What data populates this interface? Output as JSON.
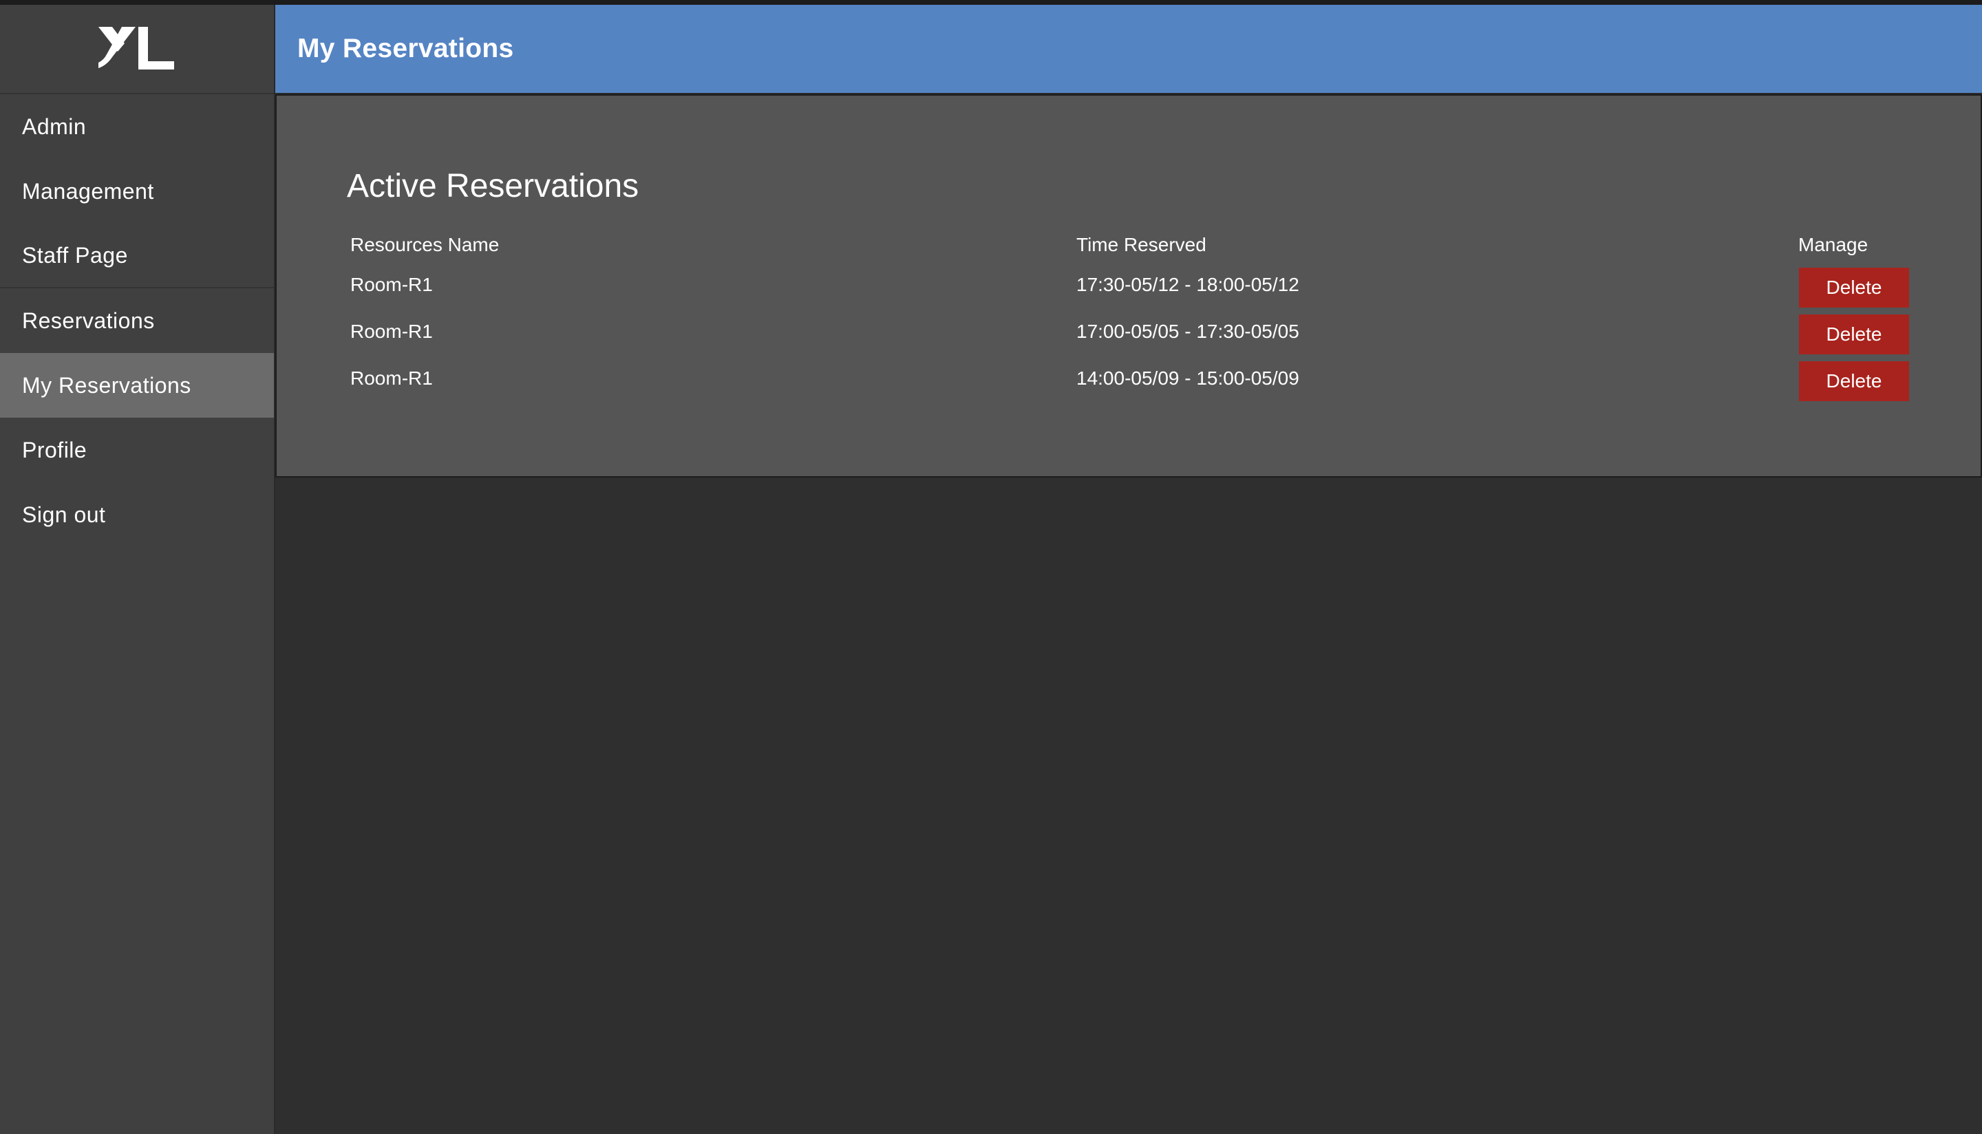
{
  "app": {
    "logo_icon": "xl-logo-icon",
    "colors": {
      "header_bg": "#5584c3",
      "sidebar_bg": "#404040",
      "active_nav_bg": "#6b6b6b",
      "panel_bg": "#555555",
      "page_bg": "#2f2f2f",
      "delete_button_bg": "#a8231d"
    }
  },
  "sidebar": {
    "items": [
      {
        "label": "Admin"
      },
      {
        "label": "Management"
      },
      {
        "label": "Staff Page"
      },
      {
        "label": "Reservations"
      },
      {
        "label": "My Reservations",
        "active": true
      },
      {
        "label": "Profile"
      },
      {
        "label": "Sign out"
      }
    ]
  },
  "header": {
    "title": "My Reservations"
  },
  "main": {
    "section_title": "Active Reservations",
    "table": {
      "columns": [
        "Resources Name",
        "Time Reserved",
        "Manage"
      ],
      "rows": [
        {
          "resource": "Room-R1",
          "time": "17:30-05/12 - 18:00-05/12",
          "action": "Delete"
        },
        {
          "resource": "Room-R1",
          "time": "17:00-05/05 - 17:30-05/05",
          "action": "Delete"
        },
        {
          "resource": "Room-R1",
          "time": "14:00-05/09 - 15:00-05/09",
          "action": "Delete"
        }
      ]
    }
  }
}
